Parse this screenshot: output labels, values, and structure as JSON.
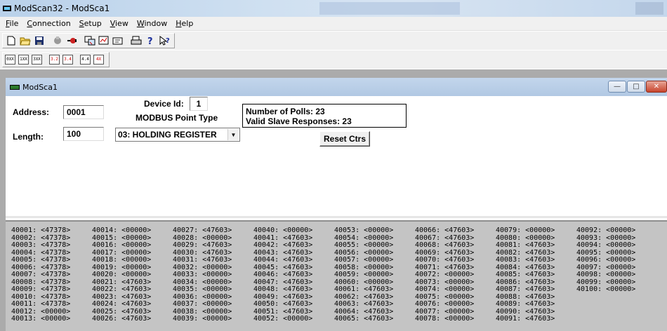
{
  "window": {
    "title": "ModScan32 - ModSca1"
  },
  "menu": [
    "File",
    "Connection",
    "Setup",
    "View",
    "Window",
    "Help"
  ],
  "menu_underline": [
    "F",
    "C",
    "S",
    "V",
    "W",
    "H"
  ],
  "toolbar1_icons": [
    "new-icon",
    "open-icon",
    "save-icon",
    "disconnect-icon",
    "connect-icon",
    "display-icon",
    "poll-icon",
    "reset-icon",
    "print-icon",
    "help-icon",
    "context-help-icon"
  ],
  "toolbar2_icons": [
    "0x",
    "1x",
    "3x",
    "3x-float",
    "4x",
    "4x-float",
    "4x-int",
    "4x-swap"
  ],
  "toolbar2_labels": [
    "0XX",
    "1XX",
    "3XX",
    "3.2",
    "3.4",
    "4.4",
    "4X"
  ],
  "child": {
    "title": "ModSca1"
  },
  "form": {
    "address_label": "Address:",
    "address_value": "0001",
    "device_label": "Device Id:",
    "device_value": "1",
    "point_type_label": "MODBUS Point Type",
    "length_label": "Length:",
    "length_value": "100",
    "point_type_value": "03: HOLDING REGISTER",
    "polls_text": "Number of Polls: 23",
    "responses_text": "Valid Slave Responses: 23",
    "reset_label": "Reset Ctrs"
  },
  "registers": {
    "40001": "<47378>",
    "40002": "<47378>",
    "40003": "<47378>",
    "40004": "<47378>",
    "40005": "<47378>",
    "40006": "<47378>",
    "40007": "<47378>",
    "40008": "<47378>",
    "40009": "<47378>",
    "40010": "<47378>",
    "40011": "<47378>",
    "40012": "<00000>",
    "40013": "<00000>",
    "40014": "<00000>",
    "40015": "<00000>",
    "40016": "<00000>",
    "40017": "<00000>",
    "40018": "<00000>",
    "40019": "<00000>",
    "40020": "<00000>",
    "40021": "<47603>",
    "40022": "<47603>",
    "40023": "<47603>",
    "40024": "<47603>",
    "40025": "<47603>",
    "40026": "<47603>",
    "40027": "<47603>",
    "40028": "<00000>",
    "40029": "<47603>",
    "40030": "<47603>",
    "40031": "<47603>",
    "40032": "<00000>",
    "40033": "<00000>",
    "40034": "<00000>",
    "40035": "<00000>",
    "40036": "<00000>",
    "40037": "<00000>",
    "40038": "<00000>",
    "40039": "<00000>",
    "40040": "<00000>",
    "40041": "<47603>",
    "40042": "<47603>",
    "40043": "<47603>",
    "40044": "<47603>",
    "40045": "<47603>",
    "40046": "<47603>",
    "40047": "<47603>",
    "40048": "<47603>",
    "40049": "<47603>",
    "40050": "<47603>",
    "40051": "<47603>",
    "40052": "<00000>",
    "40053": "<00000>",
    "40054": "<00000>",
    "40055": "<00000>",
    "40056": "<00000>",
    "40057": "<00000>",
    "40058": "<00000>",
    "40059": "<00000>",
    "40060": "<00000>",
    "40061": "<47603>",
    "40062": "<47603>",
    "40063": "<47603>",
    "40064": "<47603>",
    "40065": "<47603>",
    "40066": "<47603>",
    "40067": "<47603>",
    "40068": "<47603>",
    "40069": "<47603>",
    "40070": "<47603>",
    "40071": "<47603>",
    "40072": "<00000>",
    "40073": "<00000>",
    "40074": "<00000>",
    "40075": "<00000>",
    "40076": "<00000>",
    "40077": "<00000>",
    "40078": "<00000>",
    "40079": "<00000>",
    "40080": "<00000>",
    "40081": "<47603>",
    "40082": "<47603>",
    "40083": "<47603>",
    "40084": "<47603>",
    "40085": "<47603>",
    "40086": "<47603>",
    "40087": "<47603>",
    "40088": "<47603>",
    "40089": "<47603>",
    "40090": "<47603>",
    "40091": "<47603>",
    "40092": "<00000>",
    "40093": "<00000>",
    "40094": "<00000>",
    "40095": "<00000>",
    "40096": "<00000>",
    "40097": "<00000>",
    "40098": "<00000>",
    "40099": "<00000>",
    "40100": "<00000>"
  }
}
